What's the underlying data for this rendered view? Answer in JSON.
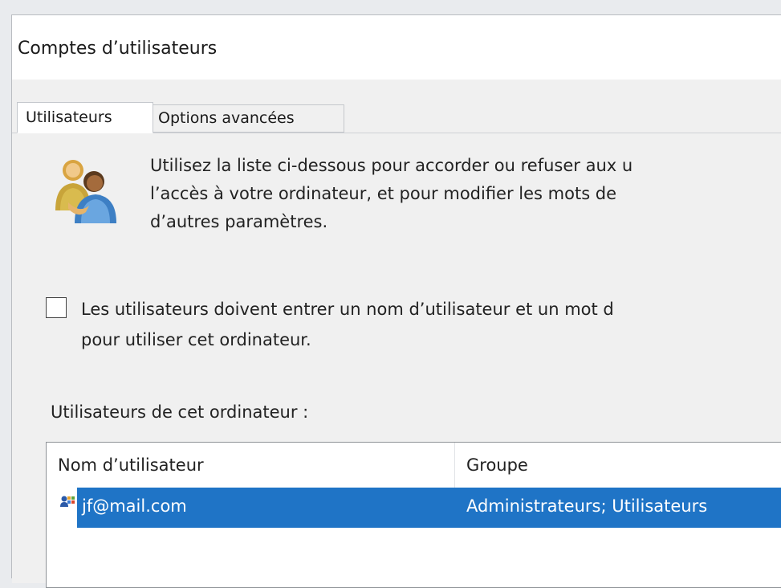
{
  "window": {
    "title": "Comptes d’utilisateurs"
  },
  "tabs": [
    {
      "label": "Utilisateurs",
      "selected": true
    },
    {
      "label": "Options avancées",
      "selected": false
    }
  ],
  "intro": {
    "icon": "users-icon",
    "lines": [
      "Utilisez la liste ci-dessous pour accorder ou refuser aux u",
      "l’accès à votre ordinateur, et pour modifier les mots de",
      "d’autres paramètres."
    ]
  },
  "require_login": {
    "checked": false,
    "lines": [
      "Les utilisateurs doivent entrer un nom d’utilisateur et un mot d",
      "pour utiliser cet ordinateur."
    ]
  },
  "users_list": {
    "caption": "Utilisateurs de cet ordinateur :",
    "columns": [
      "Nom d’utilisateur",
      "Groupe"
    ],
    "rows": [
      {
        "name": "jf@mail.com",
        "group": "Administrateurs; Utilisateurs",
        "icon": "microsoft-account-icon",
        "selected": true
      }
    ]
  },
  "colors": {
    "selection": "#1f74c6",
    "panel": "#f0f0f0"
  }
}
